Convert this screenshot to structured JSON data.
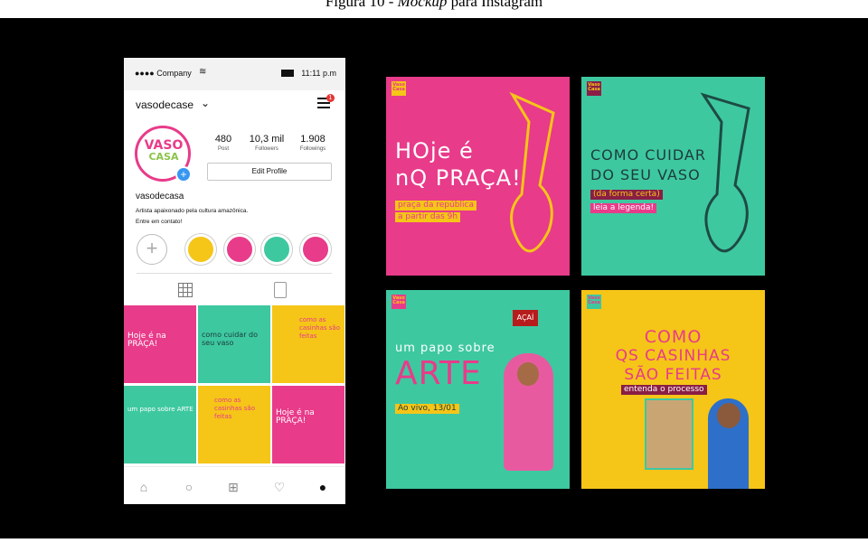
{
  "caption": {
    "prefix": "Figura 10 - ",
    "italic": "Mockup",
    "suffix": " para Instagram"
  },
  "phone": {
    "status": {
      "carrier": "●●●● Company",
      "wifi_icon": "wifi-icon",
      "time": "11:11 p.m"
    },
    "username": "vasodecase",
    "menu_badge": "1",
    "avatar": {
      "line1": "VASO",
      "line2": "CASA"
    },
    "stats": [
      {
        "value": "480",
        "label": "Post"
      },
      {
        "value": "10,3 mil",
        "label": "Followers"
      },
      {
        "value": "1.908",
        "label": "Followings"
      }
    ],
    "edit_profile": "Edit Profile",
    "bio_name": "vasodecasa",
    "bio_line1": "Artista apaixonado pela cultura amazônica.",
    "bio_line2": "Entre em contato!",
    "highlight_new": "+",
    "thumbnails": [
      {
        "text": "Hoje é na PRAÇA!"
      },
      {
        "text": "como cuidar do seu vaso"
      },
      {
        "text": "como as casinhas são feitas"
      },
      {
        "text": "um papo sobre ARTE"
      },
      {
        "text": "como as casinhas são feitas"
      },
      {
        "text": "Hoje é na PRAÇA!"
      }
    ]
  },
  "posts": [
    {
      "title_1": "HOje é",
      "title_2": "nQ PRAÇA!",
      "sub_1": "praça da república",
      "sub_2": "a partir das 9h",
      "brand": "Vaso Casa"
    },
    {
      "title_1": "COMO CUIDAR",
      "title_2": "DO SEU VASO",
      "sub_1": "(da forma certa)",
      "sub_2": "leia a legenda!",
      "brand": "Vaso Casa"
    },
    {
      "title_1": "um papo sobre",
      "title_2": "ARTE",
      "sub_1": "Ao vivo, 13/01",
      "sign": "AÇAÍ",
      "brand": "Vaso Casa"
    },
    {
      "title_1": "COMO",
      "title_2": "QS CASINHAS",
      "title_3": "SÃO FEITAS",
      "sub_1": "entenda o processo",
      "brand": "Vaso Casa"
    }
  ],
  "colors": {
    "pink": "#e83b8a",
    "teal": "#3ec8a0",
    "yellow": "#f5c518",
    "maroon": "#8a1e45"
  }
}
